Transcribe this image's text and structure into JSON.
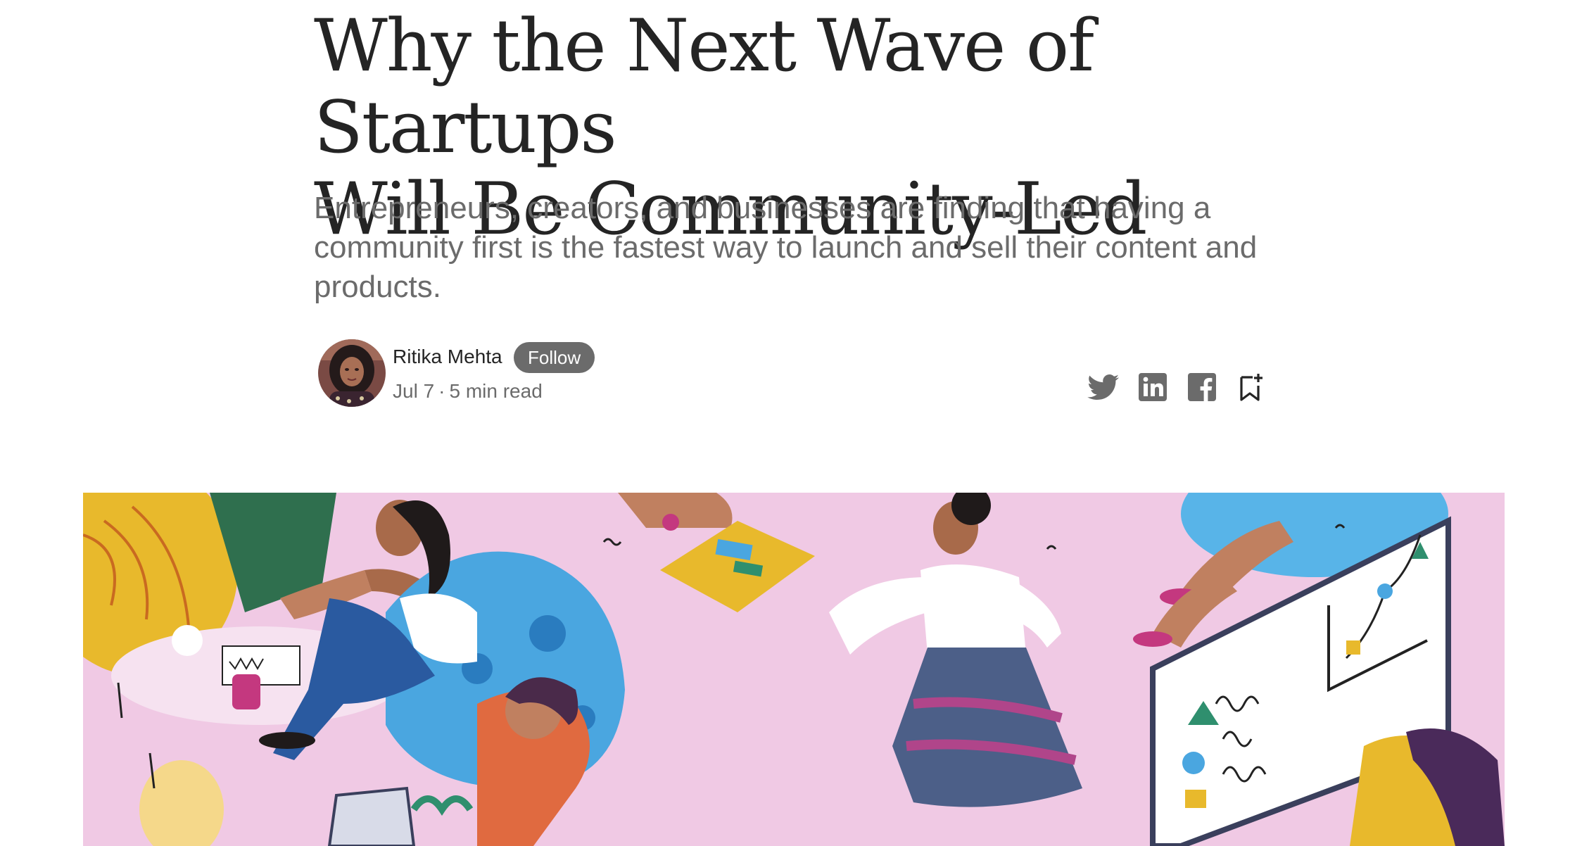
{
  "article": {
    "title_line1": "Why the Next Wave of Startups",
    "title_line2": "Will Be Community-Led",
    "subtitle": "Entrepreneurs, creators, and businesses are finding that having a community first is the fastest way to launch and sell their content and products."
  },
  "author": {
    "name": "Ritika Mehta",
    "follow_label": "Follow",
    "date": "Jul 7",
    "separator": "·",
    "read_time": "5 min read"
  },
  "share_icons": [
    "twitter-icon",
    "linkedin-icon",
    "facebook-icon",
    "bookmark-add-icon"
  ],
  "colors": {
    "text": "#242424",
    "muted": "#6b6b6b",
    "follow_bg": "#6b6b6b",
    "hero_bg": "#f0c9e4"
  }
}
